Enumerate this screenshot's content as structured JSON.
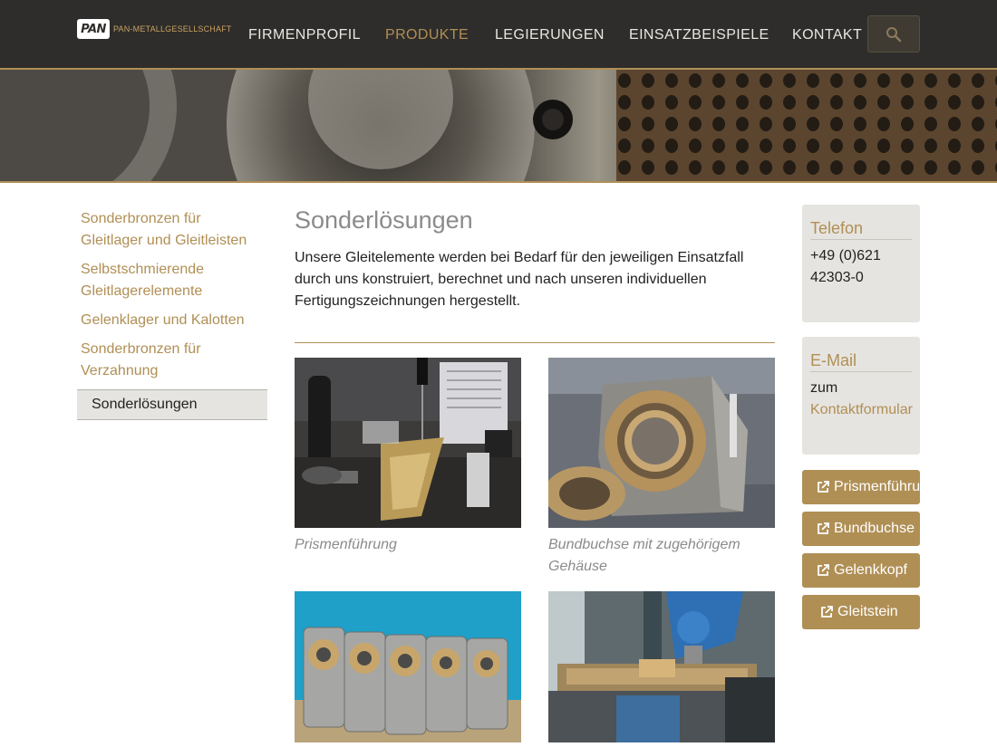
{
  "header": {
    "logo_mark": "PAN",
    "logo_text": "PAN-METALLGESELLSCHAFT",
    "nav": [
      "FIRMENPROFIL",
      "PRODUKTE",
      "LEGIERUNGEN",
      "EINSATZBEISPIELE",
      "KONTAKT"
    ],
    "active_nav": "PRODUKTE",
    "search_icon": "search-icon"
  },
  "sidebar": {
    "items": [
      "Sonderbronzen für Gleitlager und Gleitleisten",
      "Selbstschmierende Gleitlagerelemente",
      "Gelenklager und Kalotten",
      "Sonderbronzen für Verzahnung",
      "Sonderlösungen"
    ],
    "current": "Sonderlösungen"
  },
  "main": {
    "title": "Sonderlösungen",
    "intro": "Unsere Gleitelemente werden bei Bedarf für den jeweiligen Einsatzfall durch uns konstruiert, berechnet und nach unseren individuellen Fertigungszeichnungen hergestellt.",
    "gallery": [
      {
        "caption": "Prismenführung"
      },
      {
        "caption": "Bundbuchse mit zugehörigem Gehäuse"
      },
      {
        "caption": ""
      },
      {
        "caption": ""
      }
    ]
  },
  "contact": {
    "phone_title": "Telefon",
    "phone": "+49 (0)621 42303-0",
    "email_title": "E-Mail",
    "email_prefix": "zum",
    "email_link": "Kontaktformular"
  },
  "quicklinks": [
    "Prismenführung",
    "Bundbuchse",
    "Gelenkkopf",
    "Gleitstein"
  ],
  "colors": {
    "accent": "#b08f55",
    "header_bg": "#2e2d2b",
    "panel_bg": "#e6e4e0"
  }
}
